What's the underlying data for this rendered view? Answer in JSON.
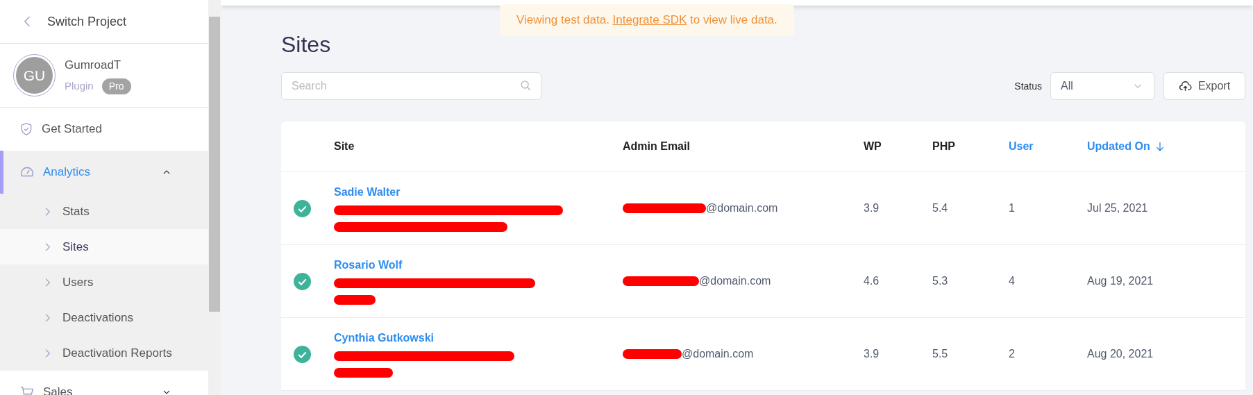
{
  "sidebar": {
    "back_link": "Switch Project",
    "profile": {
      "initials": "GU",
      "name": "GumroadT",
      "type": "Plugin",
      "plan": "Pro"
    },
    "items": [
      {
        "label": "Get Started",
        "kind": "link",
        "selected": false
      },
      {
        "label": "Analytics",
        "kind": "group",
        "expanded": true,
        "selected": true,
        "children": [
          {
            "label": "Stats",
            "selected": false
          },
          {
            "label": "Sites",
            "selected": true
          },
          {
            "label": "Users",
            "selected": false
          },
          {
            "label": "Deactivations",
            "selected": false
          },
          {
            "label": "Deactivation Reports",
            "selected": false
          }
        ]
      },
      {
        "label": "Sales",
        "kind": "group",
        "expanded": false,
        "selected": false
      }
    ]
  },
  "banner": {
    "text": "Viewing test data.",
    "link": "Integrate SDK",
    "after": "to view live data."
  },
  "page_title": "Sites",
  "search": {
    "placeholder": "Search"
  },
  "status_filter": {
    "label": "Status",
    "value": "All"
  },
  "export_button": "Export",
  "table": {
    "columns": [
      {
        "label": "Site",
        "sortable": false,
        "sorted": false
      },
      {
        "label": "Admin Email",
        "sortable": false,
        "sorted": false
      },
      {
        "label": "WP",
        "sortable": false,
        "sorted": false
      },
      {
        "label": "PHP",
        "sortable": false,
        "sorted": false
      },
      {
        "label": "User",
        "sortable": true,
        "sorted": false
      },
      {
        "label": "Updated On",
        "sortable": true,
        "sorted": true
      }
    ],
    "rows": [
      {
        "active": true,
        "name": "Sadie Walter",
        "email": "@domain.com",
        "wp": "3.9",
        "php": "5.4",
        "users": "1",
        "updated": "Jul 25, 2021"
      },
      {
        "active": true,
        "name": "Rosario Wolf",
        "email": "@domain.com",
        "wp": "4.6",
        "php": "5.3",
        "users": "4",
        "updated": "Aug 19, 2021"
      },
      {
        "active": true,
        "name": "Cynthia Gutkowski",
        "email": "@domain.com",
        "wp": "3.9",
        "php": "5.5",
        "users": "2",
        "updated": "Aug 20, 2021"
      }
    ]
  }
}
